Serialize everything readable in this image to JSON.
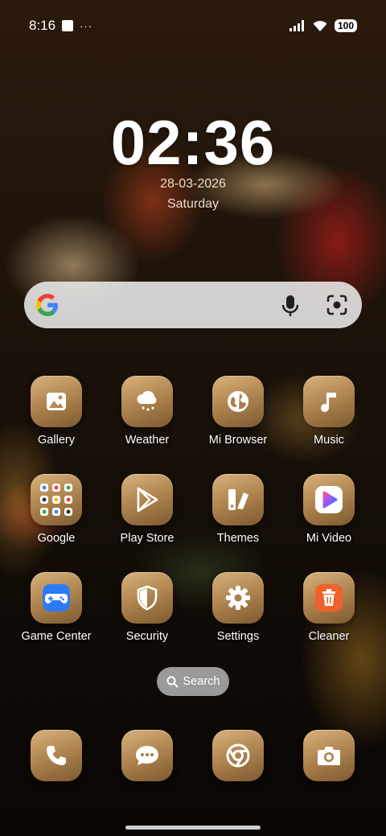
{
  "status_bar": {
    "time": "8:16",
    "dots": "···",
    "battery": "100"
  },
  "lockscreen": {
    "clock": "02:36",
    "date": "28-03-2026",
    "day": "Saturday"
  },
  "search_widget": {
    "provider": "Google",
    "mic_icon": "mic-icon",
    "lens_icon": "lens-icon"
  },
  "apps": [
    {
      "label": "Gallery",
      "icon": "gallery-icon"
    },
    {
      "label": "Weather",
      "icon": "weather-icon"
    },
    {
      "label": "Mi Browser",
      "icon": "browser-icon"
    },
    {
      "label": "Music",
      "icon": "music-icon"
    },
    {
      "label": "Google",
      "icon": "folder-icon"
    },
    {
      "label": "Play Store",
      "icon": "play-store-icon"
    },
    {
      "label": "Themes",
      "icon": "themes-icon"
    },
    {
      "label": "Mi Video",
      "icon": "video-icon"
    },
    {
      "label": "Game Center",
      "icon": "game-center-icon"
    },
    {
      "label": "Security",
      "icon": "shield-icon"
    },
    {
      "label": "Settings",
      "icon": "gear-icon"
    },
    {
      "label": "Cleaner",
      "icon": "trash-icon"
    }
  ],
  "app_search": {
    "label": "Search"
  },
  "dock": [
    {
      "icon": "phone-icon"
    },
    {
      "icon": "messages-icon"
    },
    {
      "icon": "chrome-icon"
    },
    {
      "icon": "camera-icon"
    }
  ]
}
